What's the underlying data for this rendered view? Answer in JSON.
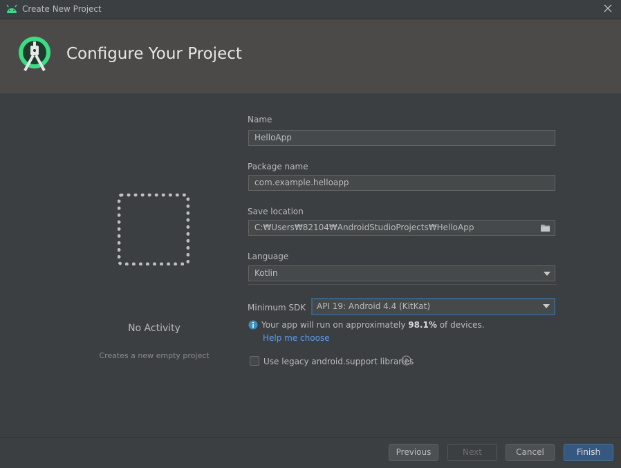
{
  "window": {
    "title": "Create New Project"
  },
  "header": {
    "title": "Configure Your Project"
  },
  "template": {
    "name": "No Activity",
    "description": "Creates a new empty project"
  },
  "form": {
    "name": {
      "label": "Name",
      "value": "HelloApp"
    },
    "package": {
      "label": "Package name",
      "value": "com.example.helloapp"
    },
    "save_location": {
      "label": "Save location",
      "value": "C:₩Users₩82104₩AndroidStudioProjects₩HelloApp"
    },
    "language": {
      "label": "Language",
      "value": "Kotlin"
    },
    "min_sdk": {
      "label": "Minimum SDK",
      "value": "API 19: Android 4.4 (KitKat)"
    },
    "coverage": {
      "prefix": "Your app will run on approximately ",
      "percent": "98.1%",
      "suffix": " of devices."
    },
    "help_link": "Help me choose",
    "legacy_label": "Use legacy android.support libraries"
  },
  "buttons": {
    "previous": "Previous",
    "next": "Next",
    "cancel": "Cancel",
    "finish": "Finish"
  },
  "colors": {
    "accent": "#365880",
    "link": "#589df6",
    "android_green": "#3ddc84"
  }
}
